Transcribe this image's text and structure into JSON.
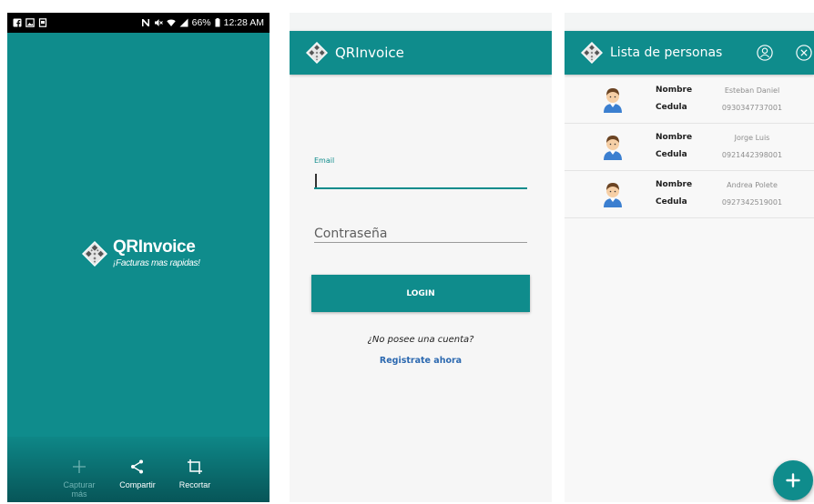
{
  "splash": {
    "status_bar": {
      "left_icons": [
        "facebook-icon",
        "image-icon",
        "screenshot-icon"
      ],
      "right_icons": [
        "nfc-icon",
        "mute-icon",
        "wifi-icon",
        "signal-icon",
        "battery-icon"
      ],
      "battery_level": "66%",
      "time": "12:28 AM"
    },
    "brand": {
      "icon": "qr-diamond-icon",
      "name": "QRInvoice",
      "tagline": "¡Facturas mas rapidas!"
    },
    "actions": [
      {
        "label": "Capturar más",
        "icon": "plus-icon",
        "enabled": false
      },
      {
        "label": "Compartir",
        "icon": "share-icon",
        "enabled": true
      },
      {
        "label": "Recortar",
        "icon": "crop-icon",
        "enabled": true
      }
    ]
  },
  "login": {
    "header_icon": "qr-diamond-icon",
    "header_title": "QRInvoice",
    "email_label": "Email",
    "email_value": "",
    "password_placeholder": "Contraseña",
    "login_label": "LOGIN",
    "no_account_text": "¿No posee una cuenta?",
    "register_link": "Registrate ahora"
  },
  "people_list": {
    "header_icon": "qr-diamond-icon",
    "header_title": "Lista de personas",
    "header_actions": [
      "user-profile-icon",
      "close-icon"
    ],
    "name_label": "Nombre",
    "id_label": "Cedula",
    "items": [
      {
        "avatar": "avatar-icon",
        "name": "Esteban Daniel",
        "cedula": "0930347737001"
      },
      {
        "avatar": "avatar-icon",
        "name": "Jorge Luis",
        "cedula": "0921442398001"
      },
      {
        "avatar": "avatar-icon",
        "name": "Andrea Polete",
        "cedula": "0927342519001"
      }
    ],
    "fab_icon": "plus-icon"
  },
  "colors": {
    "primary": "#0f8c8c",
    "link": "#2c69b0",
    "surface": "#f6f6f6",
    "status_bar": "#000000"
  }
}
